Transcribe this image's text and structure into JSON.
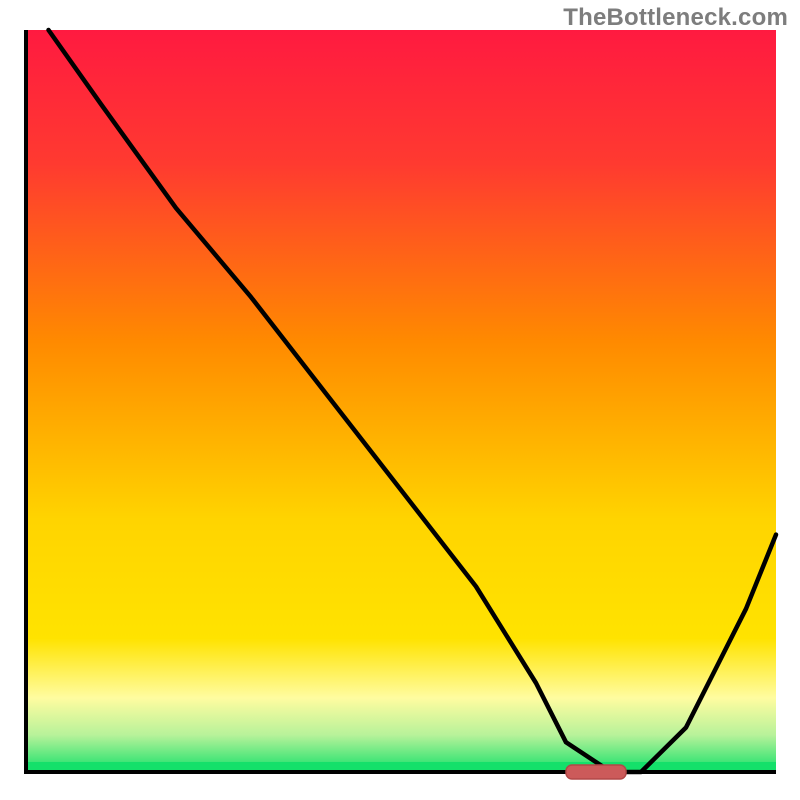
{
  "watermark": {
    "text": "TheBottleneck.com"
  },
  "colors": {
    "red_top": "#ff1a40",
    "orange_mid": "#ff8a00",
    "yellow_low": "#ffe300",
    "yellow_pale": "#fffca0",
    "green_band": "#14e06a",
    "line": "#000000",
    "marker": "#cc5a5a",
    "marker_stroke": "#b24848",
    "axis": "#000000"
  },
  "chart_data": {
    "type": "line",
    "title": "",
    "xlabel": "",
    "ylabel": "",
    "xlim": [
      0,
      100
    ],
    "ylim": [
      0,
      100
    ],
    "x": [
      3,
      10,
      20,
      25,
      30,
      40,
      50,
      60,
      68,
      72,
      78,
      82,
      88,
      96,
      100
    ],
    "values": [
      100,
      90,
      76,
      70,
      64,
      51,
      38,
      25,
      12,
      4,
      0,
      0,
      6,
      22,
      32
    ],
    "marker": {
      "x_start": 72,
      "x_end": 80,
      "y": 0
    },
    "notes": "V-shaped bottleneck curve over rainbow heat gradient; minimum near x≈75; values are percentages estimated from pixel positions (no axis labels shown)."
  }
}
